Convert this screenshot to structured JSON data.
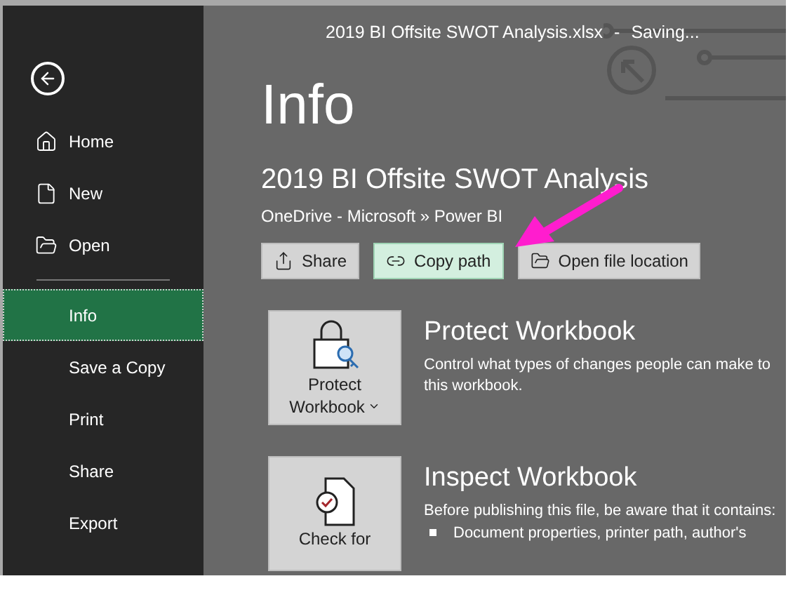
{
  "title_bar": {
    "title": "2019 BI Offsite SWOT Analysis.xlsx",
    "separator": "-",
    "status": "Saving..."
  },
  "sidebar": {
    "items": [
      {
        "label": "Home",
        "kind": "home",
        "selected": false
      },
      {
        "label": "New",
        "kind": "new",
        "selected": false
      },
      {
        "label": "Open",
        "kind": "open",
        "selected": false
      },
      {
        "label": "Info",
        "kind": "plain",
        "selected": true
      },
      {
        "label": "Save a Copy",
        "kind": "plain",
        "selected": false
      },
      {
        "label": "Print",
        "kind": "plain",
        "selected": false
      },
      {
        "label": "Share",
        "kind": "plain",
        "selected": false
      },
      {
        "label": "Export",
        "kind": "plain",
        "selected": false
      }
    ]
  },
  "page_title": "Info",
  "document": {
    "name": "2019 BI Offsite SWOT Analysis",
    "location": "OneDrive - Microsoft » Power BI"
  },
  "actions": [
    {
      "label": "Share",
      "kind": "share",
      "highlighted": false
    },
    {
      "label": "Copy path",
      "kind": "link",
      "highlighted": true
    },
    {
      "label": "Open file location",
      "kind": "folder",
      "highlighted": false
    }
  ],
  "sections": [
    {
      "kind": "protect",
      "button_lines": [
        "Protect",
        "Workbook"
      ],
      "title": "Protect Workbook",
      "description": "Control what types of changes people can make to this workbook."
    },
    {
      "kind": "inspect",
      "button_lines": [
        "Check for"
      ],
      "title": "Inspect Workbook",
      "description": "Before publishing this file, be aware that it contains:",
      "bullets": [
        "Document properties, printer path, author's"
      ]
    }
  ]
}
